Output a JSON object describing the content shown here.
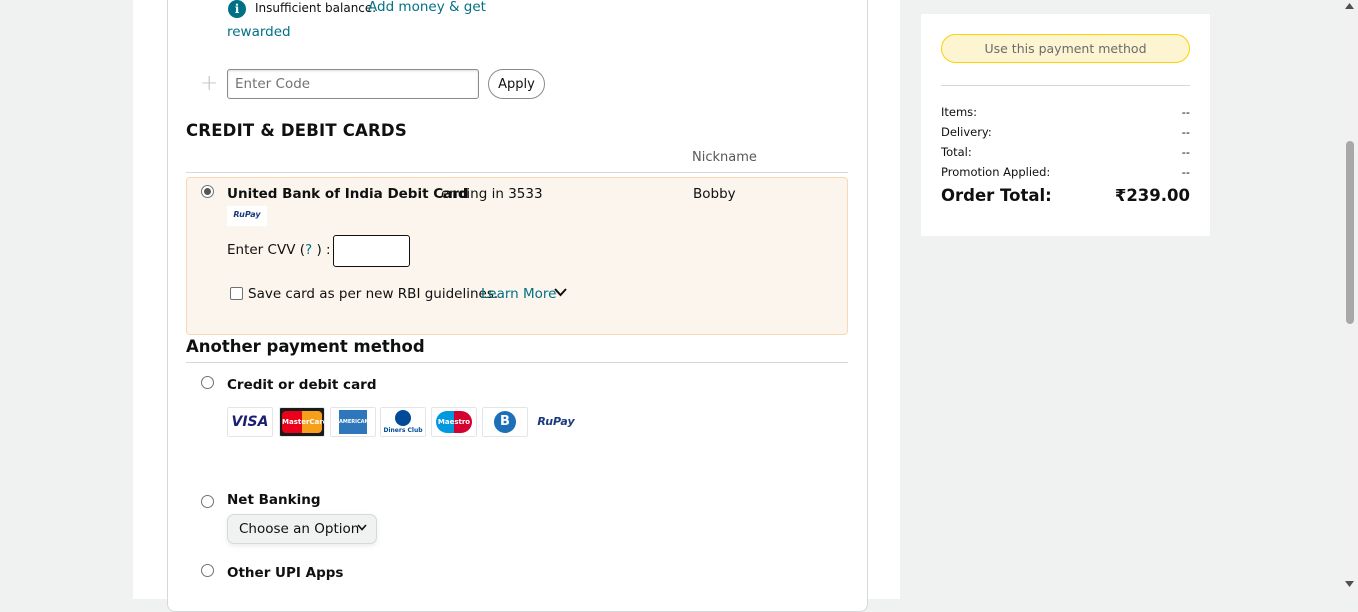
{
  "wallet": {
    "info_icon": "i",
    "insufficient": "Insufficient balance.",
    "add_money": "Add money & get",
    "rewarded": "rewarded"
  },
  "promo": {
    "plus": "+",
    "placeholder": "Enter Code",
    "apply_label": "Apply"
  },
  "cards": {
    "heading": "CREDIT & DEBIT CARDS",
    "nickname_header": "Nickname",
    "selected": {
      "name": "United Bank of India Debit Card",
      "ending": "ending in 3533",
      "nickname": "Bobby",
      "network_logo": "RuPay",
      "cvv_label": "Enter CVV (",
      "cvv_help": "?",
      "cvv_label_end": ") :",
      "save_label": "Save card as per new RBI guidelines.",
      "learn_more": "Learn More"
    }
  },
  "another": {
    "heading": "Another payment method",
    "options": [
      {
        "label": "Credit or debit card"
      },
      {
        "label": "Net Banking"
      },
      {
        "label": "Other UPI Apps"
      }
    ],
    "logos": {
      "visa": "VISA",
      "mastercard": "MasterCard",
      "amex": "AMERICAN EXPRESS",
      "diners": "Diners Club International",
      "maestro": "Maestro",
      "bajaj": "B",
      "rupay": "RuPay"
    },
    "netbanking_select": "Choose an Option"
  },
  "summary": {
    "use_button": "Use this payment method",
    "rows": [
      {
        "label": "Items:",
        "value": "--"
      },
      {
        "label": "Delivery:",
        "value": "--"
      },
      {
        "label": "Total:",
        "value": "--"
      },
      {
        "label": "Promotion Applied:",
        "value": "--"
      }
    ],
    "order_total_label": "Order Total:",
    "order_total_value": "₹239.00"
  },
  "colors": {
    "link": "#007185",
    "selected_bg": "#fcf5ee",
    "button_yellow": "#fdf4d2"
  }
}
